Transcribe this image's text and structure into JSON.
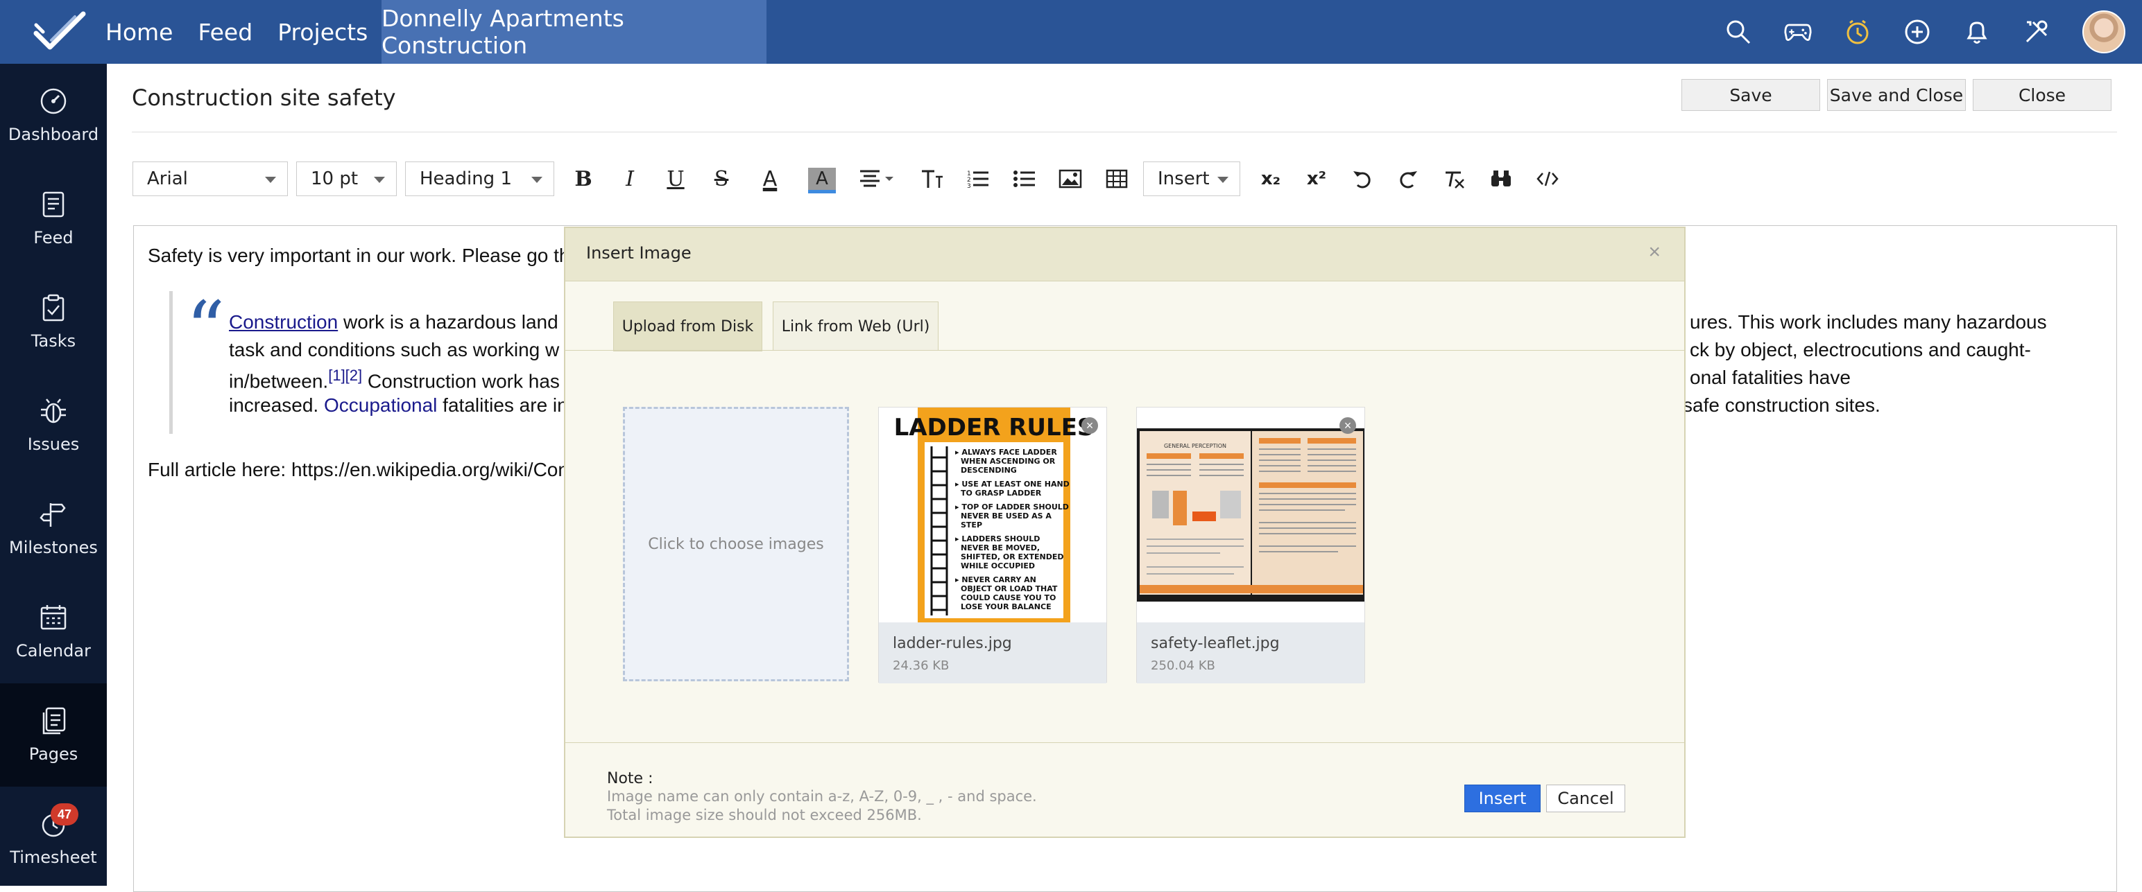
{
  "topbar": {
    "nav": [
      "Home",
      "Feed",
      "Projects"
    ],
    "project": "Donnelly Apartments Construction",
    "icons": [
      "search-icon",
      "gamepad-icon",
      "timer-icon",
      "add-icon",
      "bell-icon",
      "tools-icon",
      "avatar"
    ]
  },
  "sidebar": {
    "items": [
      {
        "label": "Dashboard",
        "icon": "dashboard-icon"
      },
      {
        "label": "Feed",
        "icon": "feed-icon"
      },
      {
        "label": "Tasks",
        "icon": "tasks-icon"
      },
      {
        "label": "Issues",
        "icon": "bug-icon"
      },
      {
        "label": "Milestones",
        "icon": "milestone-icon"
      },
      {
        "label": "Calendar",
        "icon": "calendar-icon"
      },
      {
        "label": "Pages",
        "icon": "pages-icon"
      },
      {
        "label": "Timesheet",
        "icon": "timesheet-icon"
      }
    ],
    "active": "Pages",
    "timesheet_badge": "47"
  },
  "page": {
    "title": "Construction site safety",
    "save": "Save",
    "save_close": "Save and Close",
    "close": "Close"
  },
  "toolbar": {
    "font": "Arial",
    "size": "10 pt",
    "style": "Heading 1",
    "insert": "Insert",
    "bold": "B",
    "italic": "I",
    "underline": "U",
    "strike": "S",
    "font_color": "A",
    "highlight": "A",
    "subscript": "x₂",
    "superscript": "x²"
  },
  "editor": {
    "line1": "Safety is very important in our work. Please go throu",
    "q1a": "Construction",
    "q1b": " work is a hazardous land",
    "q1c": "ures. This work includes many hazardous",
    "q2a": "task and conditions such as working w",
    "q2b": "ck by object, electrocutions and caught-",
    "q3a": "in/between.",
    "q3ref": "[1][2]",
    "q3b": " Construction work has",
    "q3c": "onal fatalities have",
    "q4a": "increased. ",
    "q4link": "Occupational",
    "q4b": " fatalities are in",
    "q4c": " safe construction sites.",
    "line_full": "Full article here: https://en.wikipedia.org/wiki/Constr"
  },
  "modal": {
    "title": "Insert Image",
    "close": "×",
    "tab_upload": "Upload from Disk",
    "tab_link": "Link from Web (Url)",
    "dropzone": "Click to choose images",
    "files": [
      {
        "name": "ladder-rules.jpg",
        "size": "24.36 KB"
      },
      {
        "name": "safety-leaflet.jpg",
        "size": "250.04 KB"
      }
    ],
    "ladder_title": "LADDER RULES",
    "ladder_rules": [
      "ALWAYS FACE LADDER WHEN ASCENDING OR DESCENDING",
      "USE AT LEAST ONE HAND TO GRASP LADDER",
      "TOP OF LADDER SHOULD NEVER BE USED AS A STEP",
      "LADDERS SHOULD NEVER BE MOVED, SHIFTED, OR EXTENDED WHILE OCCUPIED",
      "NEVER CARRY AN OBJECT OR LOAD THAT COULD CAUSE YOU TO LOSE YOUR BALANCE"
    ],
    "leaflet_heading": "GENERAL PERCEPTION",
    "note_title": "Note :",
    "note_line1": "Image name can only contain a-z, A-Z, 0-9, _ , - and space.",
    "note_line2": "Total image size should not exceed 256MB.",
    "insert": "Insert",
    "cancel": "Cancel"
  },
  "colors": {
    "topbar": "#2a5496",
    "project_tab": "#4871b3",
    "sidebar": "#0d1a32",
    "insert_button": "#2d6fe0",
    "modal_bg": "#f9f8ee"
  }
}
